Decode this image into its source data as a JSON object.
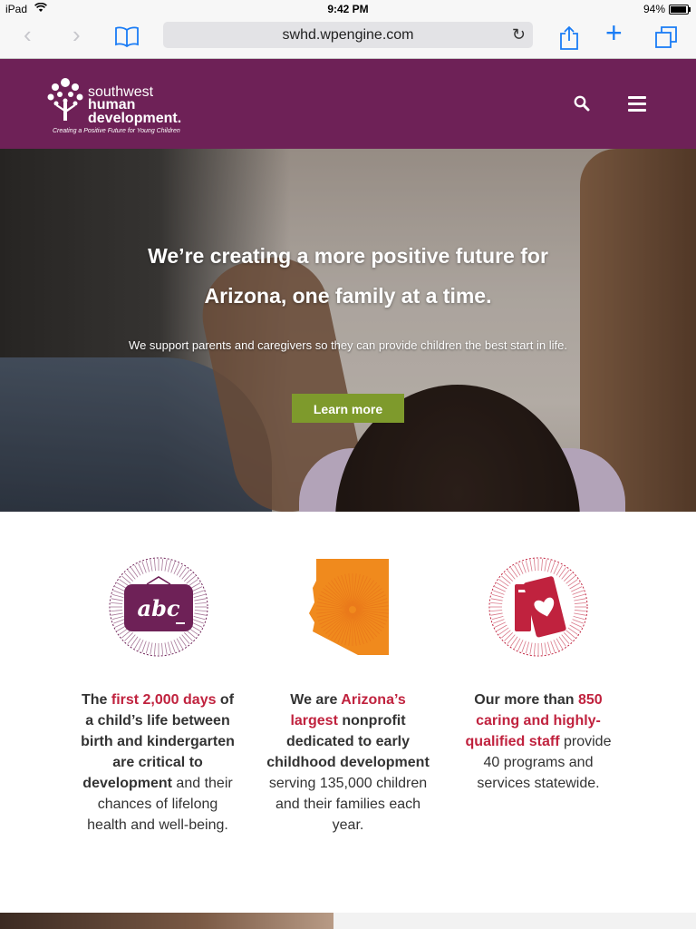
{
  "status_bar": {
    "carrier": "iPad",
    "time": "9:42 PM",
    "battery": "94%",
    "battery_level": 0.94
  },
  "browser": {
    "url": "swhd.wpengine.com"
  },
  "site": {
    "logo": {
      "line1": "southwest",
      "line2": "human",
      "line3": "development.",
      "tagline": "Creating a Positive Future for Young Children"
    }
  },
  "hero": {
    "headline_line1": "We’re creating a more positive future for",
    "headline_line2": "Arizona, one family at a time.",
    "subtext": "We support parents and caregivers so they can provide children the best start in life.",
    "cta": "Learn more"
  },
  "stats": [
    {
      "icon": "abc-chalkboard-icon",
      "parts": [
        {
          "t": "The ",
          "s": "bold"
        },
        {
          "t": "first 2,000 days",
          "s": "hl"
        },
        {
          "t": " of a child’s life between birth and kindergarten are critical to development",
          "s": "bold"
        },
        {
          "t": " and their chances of lifelong health and well-being.",
          "s": "normal"
        }
      ]
    },
    {
      "icon": "arizona-map-icon",
      "parts": [
        {
          "t": "We are ",
          "s": "bold"
        },
        {
          "t": "Arizona’s largest",
          "s": "hl"
        },
        {
          "t": " nonprofit dedicated to early childhood development",
          "s": "bold"
        },
        {
          "t": " serving 135,000 children and their families each year.",
          "s": "normal"
        }
      ]
    },
    {
      "icon": "books-heart-icon",
      "parts": [
        {
          "t": "Our more than ",
          "s": "bold"
        },
        {
          "t": "850 caring and highly-qualified staff",
          "s": "hl"
        },
        {
          "t": " provide 40 programs and services statewide.",
          "s": "normal"
        }
      ]
    }
  ],
  "colors": {
    "brand_purple": "#6e2157",
    "cta_green": "#7e9a2c",
    "highlight_red": "#c0223e",
    "arizona_orange": "#f08a1d"
  }
}
